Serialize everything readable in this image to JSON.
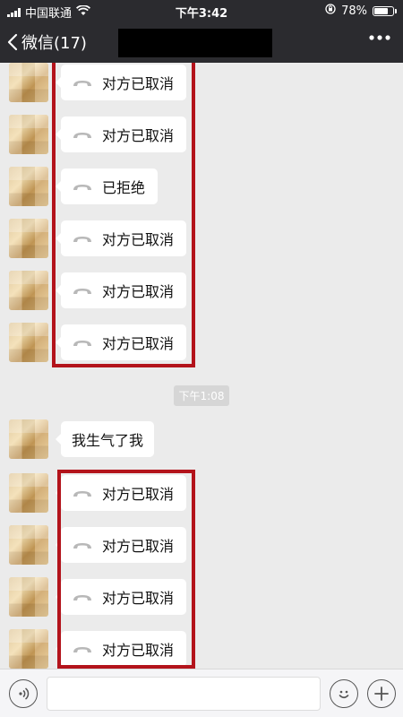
{
  "status_bar": {
    "carrier": "中国联通",
    "time": "下午3:42",
    "battery": "78%",
    "battery_level": 0.78
  },
  "nav": {
    "back_label": "微信(17)"
  },
  "messages": [
    {
      "type": "call",
      "text": "对方已取消"
    },
    {
      "type": "call",
      "text": "对方已取消"
    },
    {
      "type": "call",
      "text": "已拒绝"
    },
    {
      "type": "call",
      "text": "对方已取消"
    },
    {
      "type": "call",
      "text": "对方已取消"
    },
    {
      "type": "call",
      "text": "对方已取消"
    },
    {
      "type": "timestamp",
      "text": "下午1:08"
    },
    {
      "type": "text",
      "text": "我生气了我"
    },
    {
      "type": "call",
      "text": "对方已取消"
    },
    {
      "type": "call",
      "text": "对方已取消"
    },
    {
      "type": "call",
      "text": "对方已取消"
    },
    {
      "type": "call",
      "text": "对方已取消"
    }
  ],
  "icons": {
    "signal": "signal-icon",
    "wifi": "wifi-icon",
    "lock": "orientation-lock-icon",
    "battery": "battery-icon",
    "back": "chevron-left-icon",
    "more": "more-dots-icon",
    "phone": "phone-hangup-icon",
    "voice": "voice-icon",
    "emoji": "emoji-icon",
    "plus": "plus-icon"
  },
  "colors": {
    "header_bg": "#2b2b2f",
    "chat_bg": "#ebebeb",
    "highlight_box": "#b3131b"
  }
}
